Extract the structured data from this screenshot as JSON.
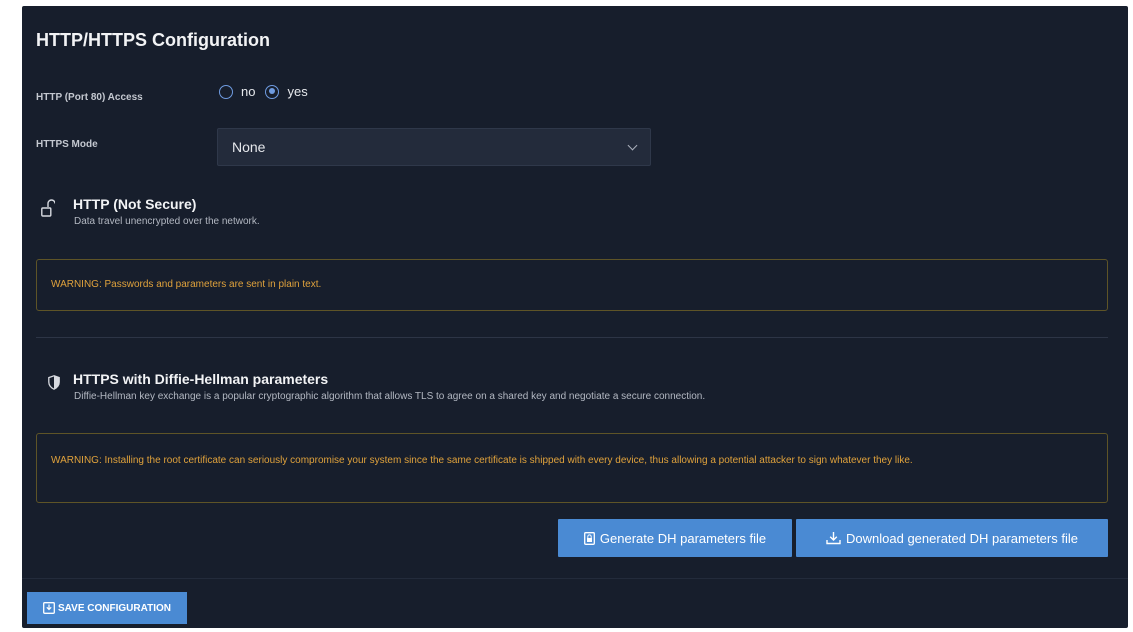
{
  "page": {
    "title": "HTTP/HTTPS Configuration"
  },
  "http_access": {
    "label": "HTTP (Port 80) Access",
    "options": [
      {
        "label": "no",
        "selected": false
      },
      {
        "label": "yes",
        "selected": true
      }
    ]
  },
  "https_mode": {
    "label": "HTTPS Mode",
    "value": "None"
  },
  "http_section": {
    "icon": "unlock-icon",
    "title": "HTTP (Not Secure)",
    "description": "Data travel unencrypted over the network.",
    "warning": "WARNING: Passwords and parameters are sent in plain text."
  },
  "dh_section": {
    "icon": "shield-icon",
    "title": "HTTPS with Diffie-Hellman parameters",
    "description": "Diffie-Hellman key exchange is a popular cryptographic algorithm that allows TLS to agree on a shared key and negotiate a secure connection.",
    "warning": "WARNING: Installing the root certificate can seriously compromise your system since the same certificate is shipped with every device, thus allowing a potential attacker to sign whatever they like."
  },
  "buttons": {
    "generate": "Generate DH parameters file",
    "download": "Download generated DH parameters file",
    "save": "SAVE CONFIGURATION"
  },
  "colors": {
    "panel_bg": "#171e2c",
    "accent": "#4a8ad3",
    "warning_text": "#e0a23c",
    "warning_border": "#5e5427"
  }
}
